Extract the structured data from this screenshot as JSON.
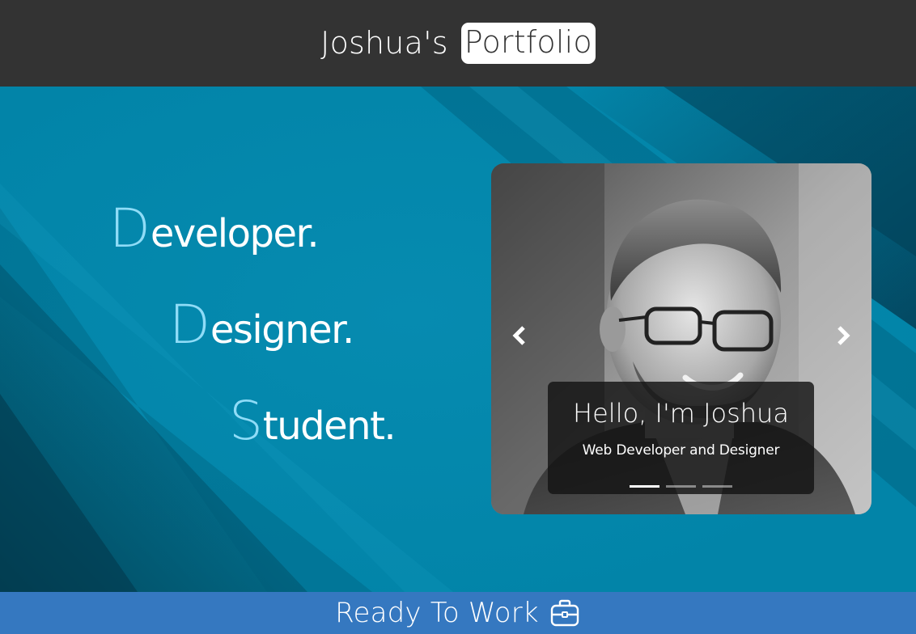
{
  "header": {
    "brand_name": "Joshua's",
    "brand_badge": "Portfolio"
  },
  "hero": {
    "words": [
      {
        "initial": "D",
        "rest": "eveloper."
      },
      {
        "initial": "D",
        "rest": "esigner."
      },
      {
        "initial": "S",
        "rest": "tudent."
      }
    ]
  },
  "carousel": {
    "caption_title": "Hello, I'm Joshua",
    "caption_subtitle": "Web Developer and Designer",
    "prev_icon": "chevron-left-icon",
    "next_icon": "chevron-right-icon",
    "slide_count": 3,
    "active_slide": 1
  },
  "cta": {
    "label": "Ready To Work",
    "icon": "briefcase-icon"
  },
  "colors": {
    "header_bg": "#333333",
    "hero_bg": "#0284a8",
    "initial_letter": "#8fdcf7",
    "cta_bg": "#3578c0"
  }
}
